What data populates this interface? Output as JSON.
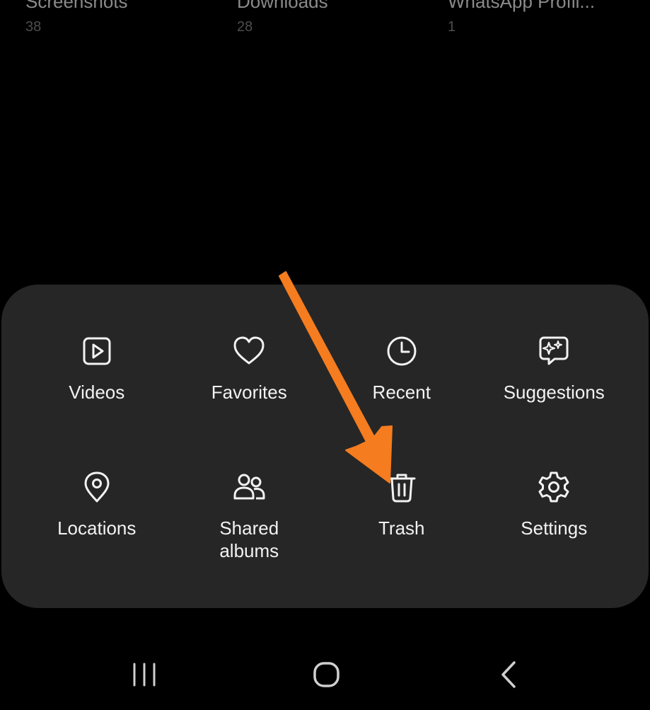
{
  "albums": [
    {
      "name": "Screenshots",
      "count": "38"
    },
    {
      "name": "Downloads",
      "count": "28"
    },
    {
      "name": "WhatsApp Profil...",
      "count": "1"
    }
  ],
  "menu": {
    "items": [
      {
        "label": "Videos",
        "icon": "video-icon"
      },
      {
        "label": "Favorites",
        "icon": "heart-icon"
      },
      {
        "label": "Recent",
        "icon": "clock-icon"
      },
      {
        "label": "Suggestions",
        "icon": "sparkle-chat-icon"
      },
      {
        "label": "Locations",
        "icon": "location-pin-icon"
      },
      {
        "label": "Shared\nalbums",
        "icon": "people-icon"
      },
      {
        "label": "Trash",
        "icon": "trash-icon"
      },
      {
        "label": "Settings",
        "icon": "gear-icon"
      }
    ]
  },
  "navbar": {
    "buttons": [
      "recents-icon",
      "home-icon",
      "back-icon"
    ]
  },
  "colors": {
    "background": "#000000",
    "panel": "#262626",
    "text": "#f2f2f2",
    "annotation_arrow": "#f57c1f"
  }
}
